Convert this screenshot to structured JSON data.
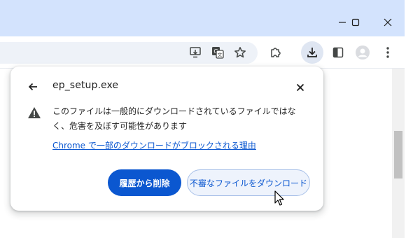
{
  "window": {
    "controls": [
      "minimize-icon",
      "maximize-icon",
      "close-icon"
    ]
  },
  "toolbar": {
    "icons": [
      "install-app-icon",
      "translate-icon",
      "bookmark-star-icon",
      "extensions-icon",
      "download-icon",
      "side-panel-icon",
      "profile-avatar-icon",
      "menu-kebab-icon"
    ]
  },
  "download_bubble": {
    "filename": "ep_setup.exe",
    "warning": "このファイルは一般的にダウンロードされているファイルではなく、危害を及ぼす可能性があります",
    "learn_more_link": "Chrome で一部のダウンロードがブロックされる理由",
    "delete_button": "履歴から削除",
    "download_button": "不審なファイルをダウンロード"
  },
  "colors": {
    "title_bar": "#d3e3fd",
    "accent": "#0b57d0",
    "secondary_button_bg": "#eef3fc"
  }
}
